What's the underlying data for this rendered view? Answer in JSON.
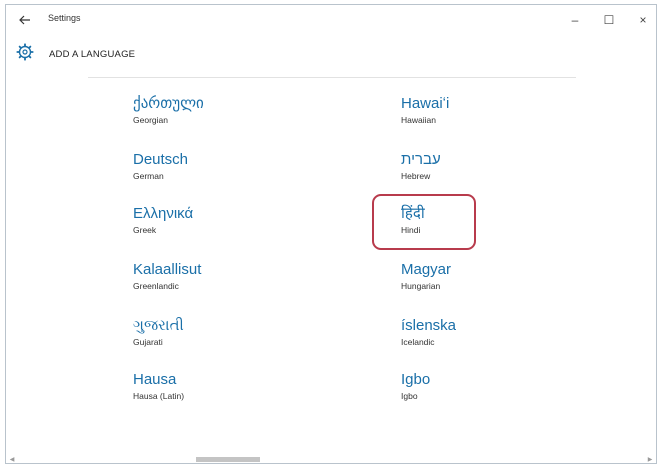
{
  "window": {
    "title": "Settings",
    "back_icon": "back-arrow-icon",
    "controls": {
      "minimize": "–",
      "maximize": "☐",
      "close": "×"
    }
  },
  "header": {
    "icon": "gear-icon",
    "title": "ADD A LANGUAGE"
  },
  "languages": [
    {
      "native": "ქართული",
      "english": "Georgian"
    },
    {
      "native": "Deutsch",
      "english": "German"
    },
    {
      "native": "Ελληνικά",
      "english": "Greek"
    },
    {
      "native": "Kalaallisut",
      "english": "Greenlandic"
    },
    {
      "native": "ગુજરાતી",
      "english": "Gujarati"
    },
    {
      "native": "Hausa",
      "english": "Hausa (Latin)"
    },
    {
      "native": "Hawaiʻi",
      "english": "Hawaiian"
    },
    {
      "native": "עברית",
      "english": "Hebrew"
    },
    {
      "native": "हिंदी",
      "english": "Hindi"
    },
    {
      "native": "Magyar",
      "english": "Hungarian"
    },
    {
      "native": "íslenska",
      "english": "Icelandic"
    },
    {
      "native": "Igbo",
      "english": "Igbo"
    }
  ],
  "highlighted_language": "Hindi",
  "colors": {
    "link_blue": "#1a6fa8",
    "highlight_border": "#b83b4c"
  }
}
